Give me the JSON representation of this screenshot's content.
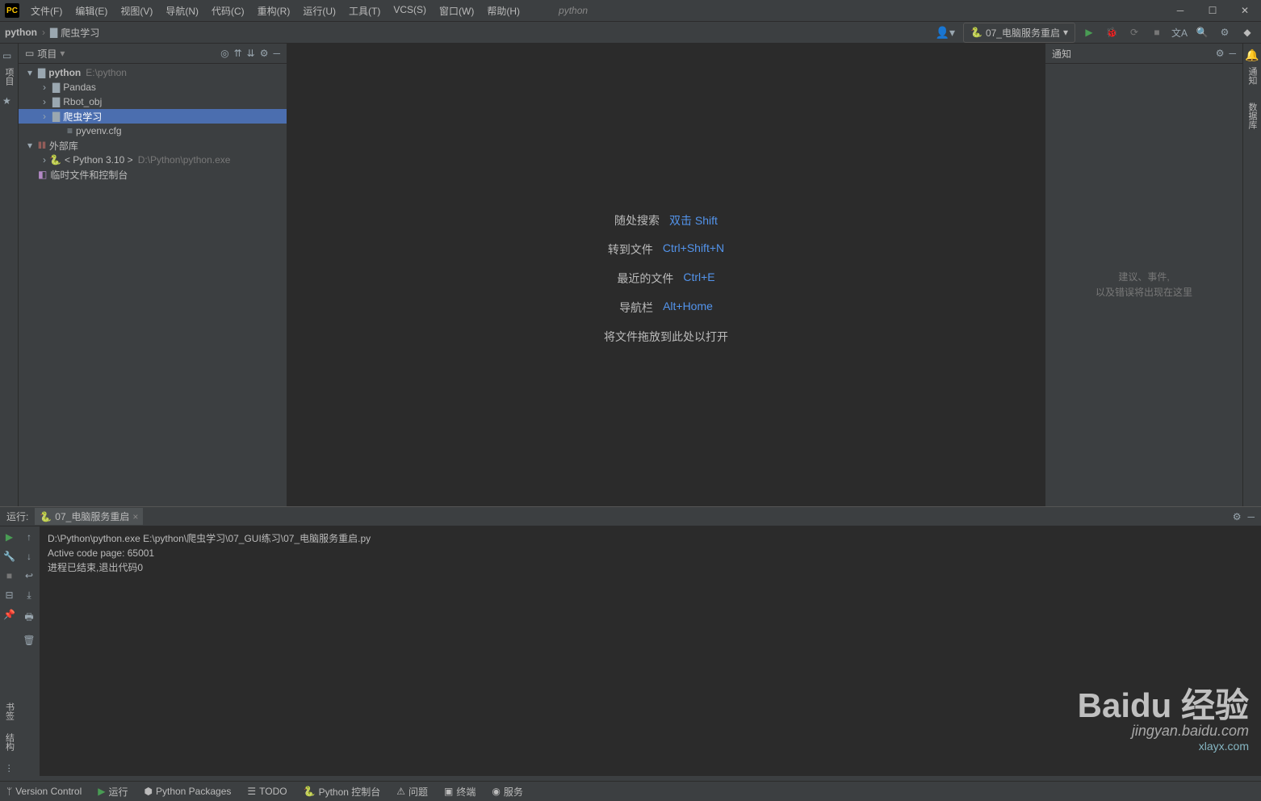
{
  "app_icon": "PC",
  "menu": [
    "文件(F)",
    "编辑(E)",
    "视图(V)",
    "导航(N)",
    "代码(C)",
    "重构(R)",
    "运行(U)",
    "工具(T)",
    "VCS(S)",
    "窗口(W)",
    "帮助(H)"
  ],
  "title": "python",
  "breadcrumb": {
    "root": "python",
    "folder": "爬虫学习"
  },
  "run_config_label": "07_电脑服务重启",
  "project_panel_title": "项目",
  "tree": {
    "root": {
      "name": "python",
      "path": "E:\\python"
    },
    "children": [
      "Pandas",
      "Rbot_obj",
      "爬虫学习",
      "pyvenv.cfg"
    ],
    "external": "外部库",
    "python_lib": "< Python 3.10 >",
    "python_lib_path": "D:\\Python\\python.exe",
    "scratch": "临时文件和控制台"
  },
  "notif_title": "通知",
  "notif_msg1": "建议、事件,",
  "notif_msg2": "以及错误将出现在这里",
  "hints": {
    "search": {
      "label": "随处搜索",
      "key": "双击 Shift"
    },
    "goto": {
      "label": "转到文件",
      "key": "Ctrl+Shift+N"
    },
    "recent": {
      "label": "最近的文件",
      "key": "Ctrl+E"
    },
    "nav": {
      "label": "导航栏",
      "key": "Alt+Home"
    },
    "drop": "将文件拖放到此处以打开"
  },
  "run_panel": {
    "title": "运行:",
    "tab": "07_电脑服务重启",
    "lines": [
      "D:\\Python\\python.exe E:\\python\\爬虫学习\\07_GUI练习\\07_电脑服务重启.py",
      "Active code page: 65001",
      "",
      "进程已结束,退出代码0"
    ]
  },
  "sidebar_left": {
    "project": "项目",
    "structure": "结构",
    "bookmark": "书签"
  },
  "sidebar_right": {
    "notif": "通知",
    "db": "数据库"
  },
  "statusbar": {
    "vc": "Version Control",
    "run": "运行",
    "packages": "Python Packages",
    "todo": "TODO",
    "console": "Python 控制台",
    "problems": "问题",
    "terminal": "终端",
    "services": "服务"
  },
  "watermark": {
    "big": "Baidu 经验",
    "sub": "jingyan.baidu.com",
    "game": "xlayx.com"
  }
}
